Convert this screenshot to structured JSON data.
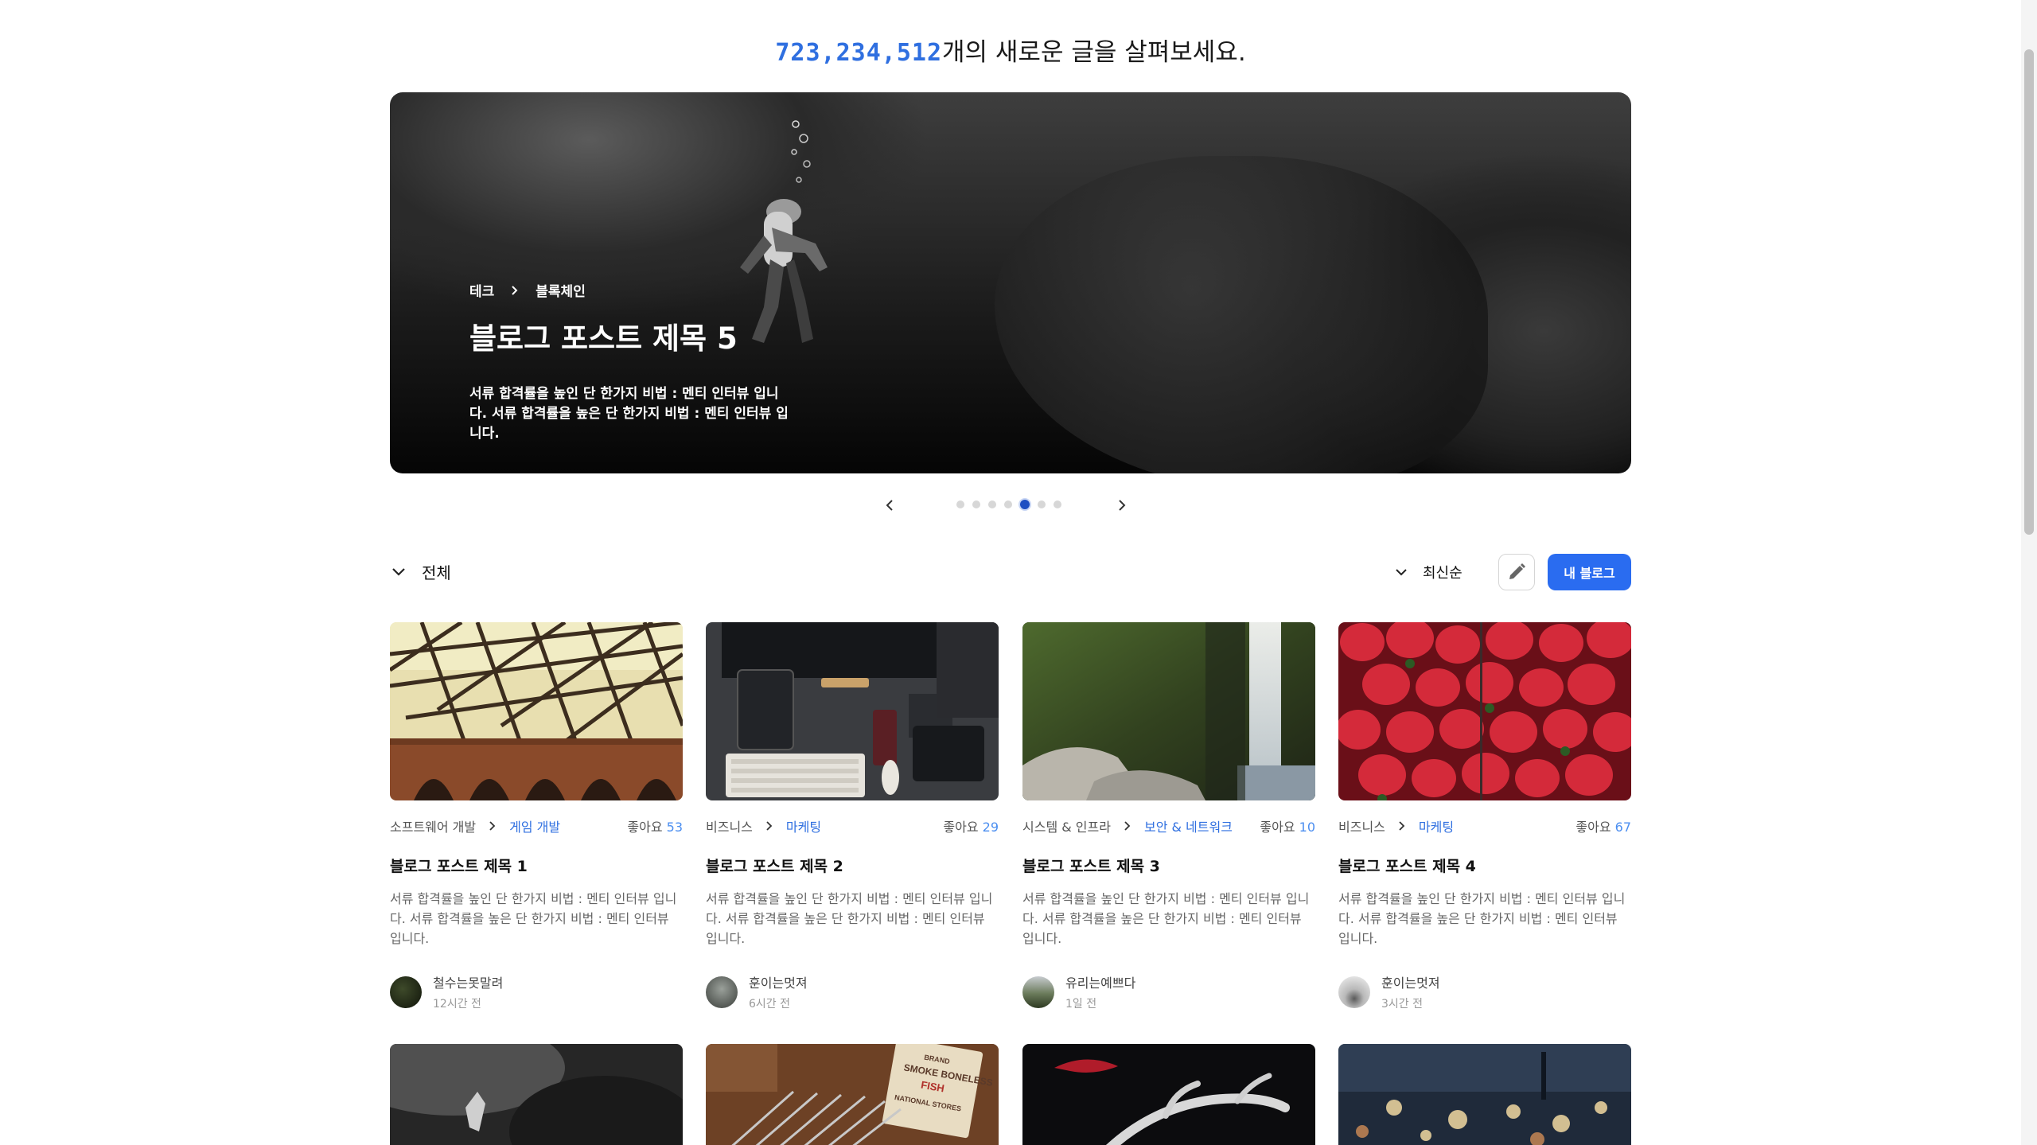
{
  "headline": {
    "count": "723,234,512",
    "text": "개의 새로운 글을 살펴보세요."
  },
  "hero": {
    "category": "테크",
    "subcategory": "블록체인",
    "title": "블로그 포스트 제목 5",
    "description": "서류 합격률을 높인 단 한가지 비법 : 멘티 인터뷰 입니다. 서류 합격률을 높은 단 한가지 비법 : 멘티 인터뷰 입니다."
  },
  "carousel": {
    "total": 7,
    "active_index": 4
  },
  "filter": {
    "all_label": "전체",
    "sort_label": "최신순",
    "my_blog_label": "내 블로그"
  },
  "posts": [
    {
      "category": "소프트웨어 개발",
      "subcategory": "게임 개발",
      "likes_label": "좋아요",
      "likes": "53",
      "title": "블로그 포스트 제목 1",
      "description": "서류 합격률을 높인 단 한가지 비법 : 멘티 인터뷰 입니다. 서류 합격률을 높은 단 한가지 비법 : 멘티 인터뷰 입니다.",
      "author": "철수는못말려",
      "time": "12시간 전"
    },
    {
      "category": "비즈니스",
      "subcategory": "마케팅",
      "likes_label": "좋아요",
      "likes": "29",
      "title": "블로그 포스트 제목 2",
      "description": "서류 합격률을 높인 단 한가지 비법 : 멘티 인터뷰 입니다. 서류 합격률을 높은 단 한가지 비법 : 멘티 인터뷰 입니다.",
      "author": "훈이는멋져",
      "time": "6시간 전"
    },
    {
      "category": "시스템 & 인프라",
      "subcategory": "보안 & 네트워크",
      "likes_label": "좋아요",
      "likes": "10",
      "title": "블로그 포스트 제목 3",
      "description": "서류 합격률을 높인 단 한가지 비법 : 멘티 인터뷰 입니다. 서류 합격률을 높은 단 한가지 비법 : 멘티 인터뷰 입니다.",
      "author": "유리는예쁘다",
      "time": "1일 전"
    },
    {
      "category": "비즈니스",
      "subcategory": "마케팅",
      "likes_label": "좋아요",
      "likes": "67",
      "title": "블로그 포스트 제목 4",
      "description": "서류 합격률을 높인 단 한가지 비법 : 멘티 인터뷰 입니다. 서류 합격률을 높은 단 한가지 비법 : 멘티 인터뷰 입니다.",
      "author": "훈이는멋져",
      "time": "3시간 전"
    }
  ],
  "row2_signage": [
    "BRAND",
    "SMOKE BONELESS",
    "FISH",
    "NATIONAL STORES"
  ],
  "colors": {
    "accent": "#2a6cf0",
    "count": "#2f6fe0",
    "likes": "#4b8ef0",
    "dot_active": "#1d4fc2"
  },
  "icons": [
    "chevron-left-icon",
    "chevron-right-icon",
    "chevron-down-icon",
    "pencil-icon"
  ]
}
